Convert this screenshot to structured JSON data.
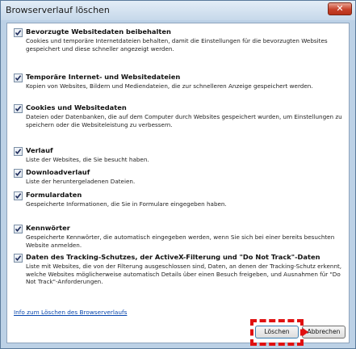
{
  "window": {
    "title": "Browserverlauf löschen",
    "close_label": "✕"
  },
  "options": [
    {
      "label": "Bevorzugte Websitedaten beibehalten",
      "description": "Cookies und temporäre Internetdateien behalten, damit die Einstellungen für die bevorzugten Websites gespeichert und diese schneller angezeigt werden.",
      "checked": true
    },
    {
      "label": "Temporäre Internet- und Websitedateien",
      "description": "Kopien von Websites, Bildern und Mediendateien, die zur schnelleren Anzeige gespeichert werden.",
      "checked": true
    },
    {
      "label": "Cookies und Websitedaten",
      "description": "Dateien oder Datenbanken, die auf dem Computer durch Websites gespeichert wurden, um Einstellungen zu speichern oder die Websiteleistung zu verbessern.",
      "checked": true
    },
    {
      "label": "Verlauf",
      "description": "Liste der Websites, die Sie besucht haben.",
      "checked": true
    },
    {
      "label": "Downloadverlauf",
      "description": "Liste der heruntergeladenen Dateien.",
      "checked": true
    },
    {
      "label": "Formulardaten",
      "description": "Gespeicherte Informationen, die Sie in Formulare eingegeben haben.",
      "checked": true
    },
    {
      "label": "Kennwörter",
      "description": "Gespeicherte Kennwörter, die automatisch eingegeben werden, wenn Sie sich bei einer bereits besuchten Website anmelden.",
      "checked": true
    },
    {
      "label": "Daten des Tracking-Schutzes, der ActiveX-Filterung und \"Do Not Track\"-Daten",
      "description": "Liste mit Websites, die von der Filterung ausgeschlossen sind, Daten, an denen der Tracking-Schutz erkennt, welche Websites möglicherweise automatisch Details über einen Besuch freigeben, und Ausnahmen für \"Do Not Track\"-Anforderungen.",
      "checked": true
    }
  ],
  "footer": {
    "help_link": "Info zum Löschen des Browserverlaufs",
    "delete_button": "Löschen",
    "cancel_button": "Abbrechen"
  },
  "colors": {
    "highlight": "#e01010",
    "link": "#0645ad"
  }
}
